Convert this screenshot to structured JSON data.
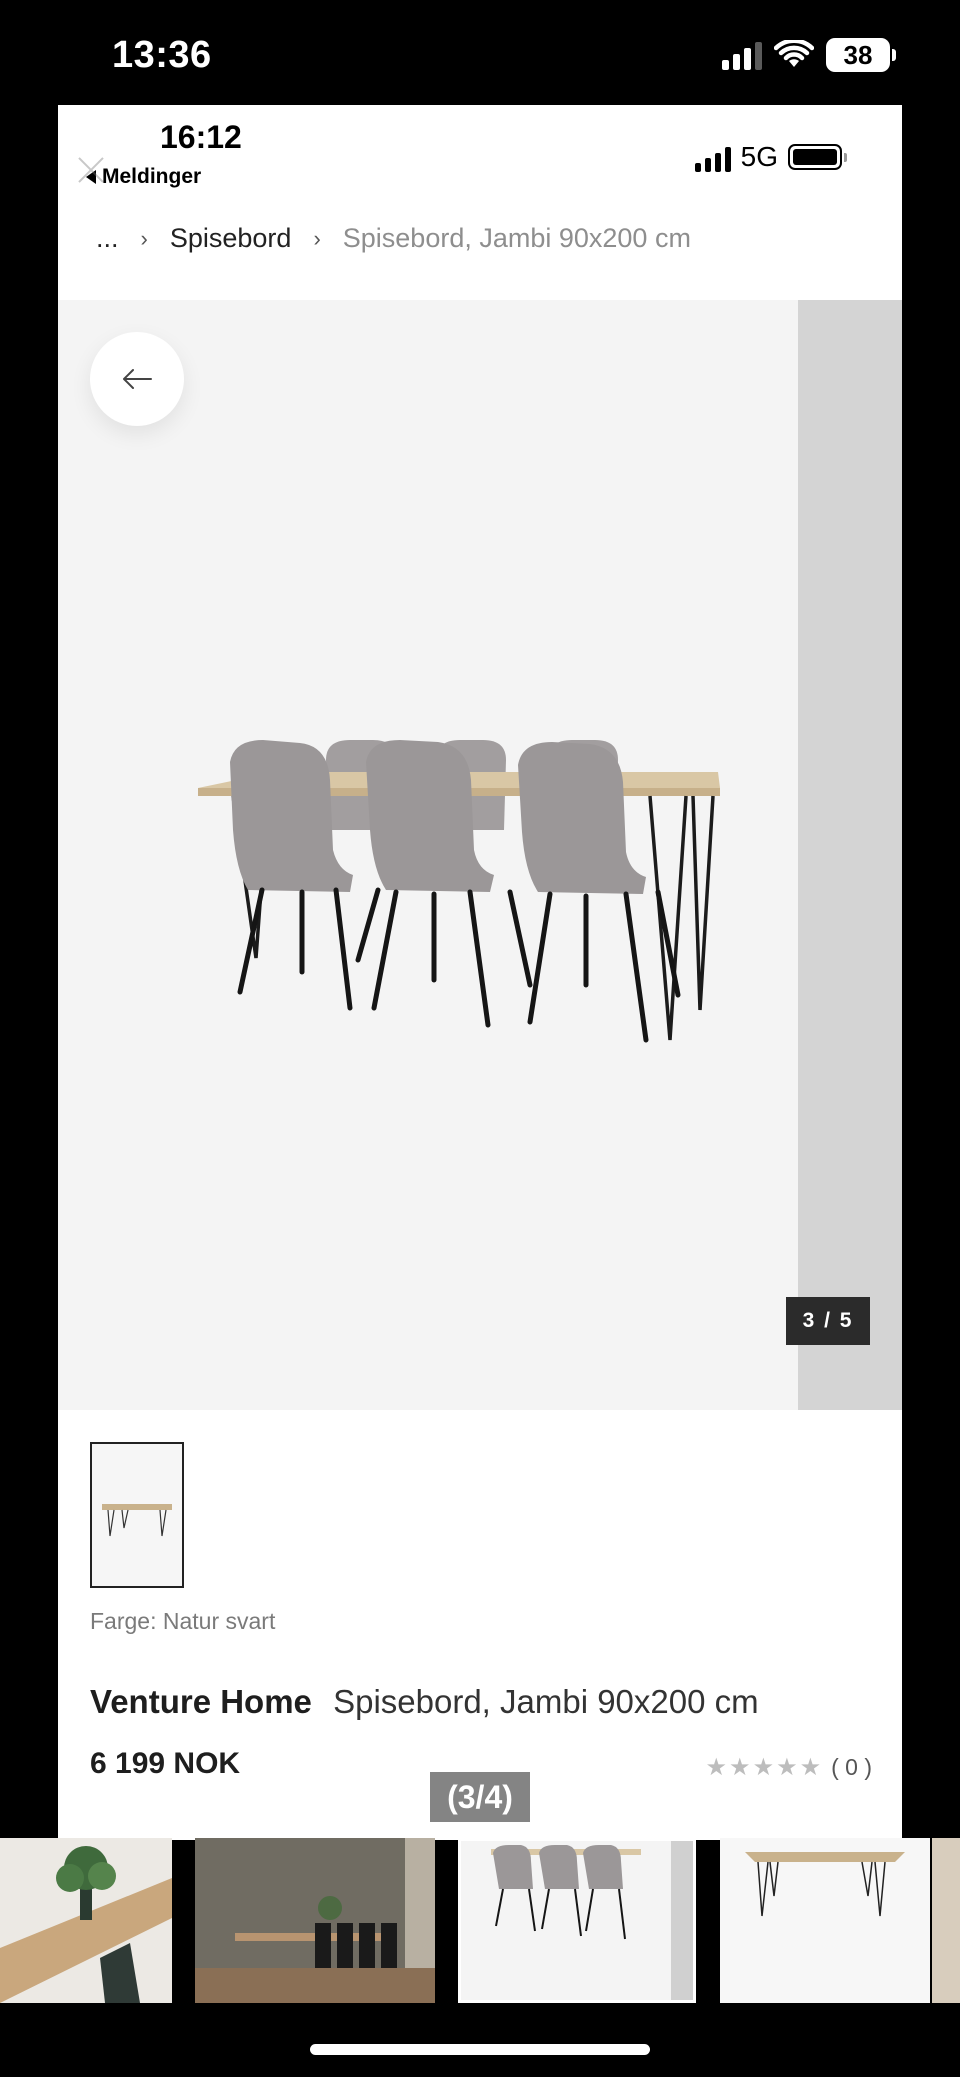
{
  "os": {
    "time": "13:36",
    "battery": "38"
  },
  "inner": {
    "time": "16:12",
    "back_app": "Meldinger",
    "network": "5G"
  },
  "breadcrumb": {
    "ellipsis": "...",
    "category": "Spisebord",
    "current": "Spisebord, Jambi 90x200 cm"
  },
  "gallery": {
    "counter": "3 / 5"
  },
  "product": {
    "color_label": "Farge: Natur svart",
    "brand": "Venture Home",
    "name": "Spisebord, Jambi 90x200 cm",
    "price": "6 199 NOK",
    "stars": "★★★★★",
    "rating_count": "( 0 )"
  },
  "overlay": {
    "counter": "(3/4)"
  },
  "colors": {
    "gallery_bg": "#f4f4f4",
    "chair_gray": "#9e9a9b",
    "table_wood": "#d9c7a5"
  }
}
